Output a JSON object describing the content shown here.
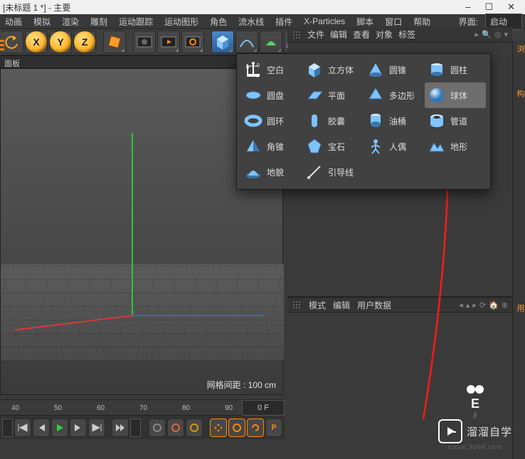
{
  "title": "[未标题 1 *] - 主要",
  "menu": [
    "动画",
    "模拟",
    "渲染",
    "雕刻",
    "运动跟踪",
    "运动图形",
    "角色",
    "流水线",
    "插件",
    "X-Particles",
    "脚本",
    "窗口",
    "帮助"
  ],
  "interface_label": "界面:",
  "interface_value": "启动",
  "axis": {
    "x": "X",
    "y": "Y",
    "z": "Z"
  },
  "panel_label": "面板",
  "grid_label": "网格间距 : 100 cm",
  "timeline": {
    "ticks": [
      "40",
      "50",
      "60",
      "70",
      "80",
      "90"
    ],
    "temp": "0 F"
  },
  "obj_menu": [
    "文件",
    "编辑",
    "查看",
    "对象",
    "标签"
  ],
  "attr_menu": [
    "模式",
    "编辑",
    "用户数据"
  ],
  "primitives": [
    [
      {
        "k": "null",
        "label": "空白",
        "icon": "null"
      },
      {
        "k": "cube",
        "label": "立方体",
        "icon": "cube"
      },
      {
        "k": "cone",
        "label": "圆锥",
        "icon": "cone"
      },
      {
        "k": "cylinder",
        "label": "圆柱",
        "icon": "cylinder"
      }
    ],
    [
      {
        "k": "disc",
        "label": "圆盘",
        "icon": "disc"
      },
      {
        "k": "plane",
        "label": "平面",
        "icon": "plane"
      },
      {
        "k": "polygon",
        "label": "多边形",
        "icon": "polygon"
      },
      {
        "k": "sphere",
        "label": "球体",
        "icon": "sphere",
        "hl": true
      }
    ],
    [
      {
        "k": "torus",
        "label": "圆环",
        "icon": "torus"
      },
      {
        "k": "capsule",
        "label": "胶囊",
        "icon": "capsule"
      },
      {
        "k": "oiltank",
        "label": "油桶",
        "icon": "oiltank"
      },
      {
        "k": "tube",
        "label": "管道",
        "icon": "tube"
      }
    ],
    [
      {
        "k": "pyramid",
        "label": "角锥",
        "icon": "pyramid"
      },
      {
        "k": "platonic",
        "label": "宝石",
        "icon": "platonic"
      },
      {
        "k": "figure",
        "label": "人偶",
        "icon": "figure"
      },
      {
        "k": "landscape",
        "label": "地形",
        "icon": "landscape"
      }
    ],
    [
      {
        "k": "relief",
        "label": "地貌",
        "icon": "relief"
      },
      {
        "k": "guide",
        "label": "引导线",
        "icon": "guide"
      }
    ]
  ],
  "watermark": {
    "brand": "溜溜自学",
    "sub": "zixue.3d66.com",
    "cut": "E",
    "bottom": "ji"
  }
}
